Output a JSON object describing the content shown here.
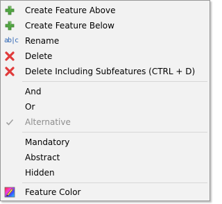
{
  "menu": {
    "items": [
      {
        "label": "Create Feature Above",
        "icon": "green-plus-icon"
      },
      {
        "label": "Create Feature Below",
        "icon": "green-plus-icon"
      },
      {
        "label": "Rename",
        "icon": "rename-abc-icon",
        "icon_text": "ab|c"
      },
      {
        "label": "Delete",
        "icon": "red-x-icon"
      },
      {
        "label": "Delete Including Subfeatures (CTRL + D)",
        "icon": "red-x-icon"
      },
      {
        "label": "And"
      },
      {
        "label": "Or"
      },
      {
        "label": "Alternative",
        "icon": "checkmark-icon",
        "state": "disabled-checked"
      },
      {
        "label": "Mandatory"
      },
      {
        "label": "Abstract"
      },
      {
        "label": "Hidden"
      },
      {
        "label": "Feature Color",
        "icon": "color-palette-icon"
      }
    ]
  },
  "colors": {
    "menu_background": "#f2f2f2",
    "plus_green": "#52a643",
    "delete_red": "#e03a3a",
    "disabled_text": "#8d8d8d",
    "rename_icon_blue": "#2b64b4"
  }
}
